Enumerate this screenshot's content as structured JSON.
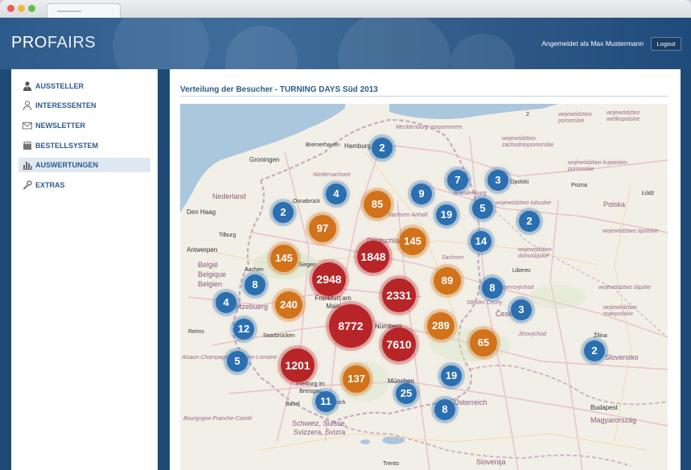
{
  "header": {
    "logo_pro": "PRO",
    "logo_fairs": "FAIRS",
    "user_text": "Angemeldet als Max Mustermann",
    "logout_label": "Logout"
  },
  "sidebar": {
    "items": [
      {
        "label": "AUSSTELLER",
        "icon": "user-suit-icon",
        "active": false
      },
      {
        "label": "INTERESSENTEN",
        "icon": "user-outline-icon",
        "active": false
      },
      {
        "label": "NEWSLETTER",
        "icon": "envelope-icon",
        "active": false
      },
      {
        "label": "BESTELLSYSTEM",
        "icon": "cart-icon",
        "active": false
      },
      {
        "label": "AUSWERTUNGEN",
        "icon": "bar-chart-icon",
        "active": true
      },
      {
        "label": "EXTRAS",
        "icon": "wrench-icon",
        "active": false
      }
    ]
  },
  "main": {
    "title": "Verteilung der Besucher - TURNING DAYS Süd 2013"
  },
  "map": {
    "labels": {
      "hamburg": "Hamburg",
      "bremerhaven": "Bremerhaven",
      "groningen": "Groningen",
      "nederland": "Nederland",
      "den_haag": "Den Haag",
      "osnabruck": "Osnabrück",
      "niedersachsen": "Niedersachsen",
      "sachsen_anhalt": "Sachsen-Anhalt",
      "brandenburg": "Brandenburg",
      "deutschland": "Deutschland",
      "sachsen": "Sachsen",
      "antwerpen": "Antwerpen",
      "belgie": "België",
      "belgique": "Belgique",
      "belgien": "Belgien",
      "aachen": "Aachen",
      "siegen": "Siegen",
      "frankfurt": "Frankfurt am Main",
      "letzebuerg": "Lëtzebuerg",
      "reims": "Reims",
      "saarbrucken": "Saarbrücken",
      "nurnberg": "Nürnberg",
      "alsace": "Alsace-Champagne-Ardenne-Lorraine",
      "freiburg": "Freiburg im Breisgau",
      "basel": "Basel",
      "munchen": "München",
      "osterreich": "Österreich",
      "schweiz": "Schweiz, Suisse, Svizzera, Svizra",
      "bourgogne": "Bourgogne-Franche-Comté",
      "polska": "Polska",
      "ceska": "Česká",
      "slovensko": "Slovensko",
      "budapest": "Budapest",
      "magyarorszag": "Magyarország",
      "slovenija": "Slovenija",
      "liberec": "Liberec",
      "zilina": "Žilina",
      "pomorskie": "województwo pomorskie",
      "zachodniopomorskie": "województwo zachodniopomorskie",
      "lubuskie": "województwo lubuskie",
      "dolnoslaskie": "województwo dolnośląskie",
      "kujawsko": "województwo kujawsko-pomorskie",
      "wielkopolskie": "województwo wielkopolskie",
      "opolskie": "województwo opolskie",
      "slaskie": "województwo śląskie",
      "malopolskie": "województwo małopolskie",
      "mecklenburg": "Mecklenburg-Vorpommern",
      "tilburg": "Tilburg",
      "trento": "Trento",
      "zurich": "Zürich",
      "stredni_cechy": "Střední Čechy",
      "severovychod": "Severovýchod",
      "jihovychod": "Jihovýchod",
      "lodz": "Łódź",
      "pozna": "Pozna",
      "opolski": "Opolski",
      "sz_num": "2"
    },
    "clusters": [
      {
        "value": "2",
        "color": "#2c6fb0"
      },
      {
        "value": "7",
        "color": "#2c6fb0"
      },
      {
        "value": "3",
        "color": "#2c6fb0"
      },
      {
        "value": "4",
        "color": "#2c6fb0"
      },
      {
        "value": "85",
        "color": "#d2731c"
      },
      {
        "value": "9",
        "color": "#2c6fb0"
      },
      {
        "value": "2",
        "color": "#2c6fb0"
      },
      {
        "value": "19",
        "color": "#2c6fb0"
      },
      {
        "value": "5",
        "color": "#2c6fb0"
      },
      {
        "value": "2",
        "color": "#2c6fb0"
      },
      {
        "value": "97",
        "color": "#d2731c"
      },
      {
        "value": "145",
        "color": "#d2731c"
      },
      {
        "value": "14",
        "color": "#2c6fb0"
      },
      {
        "value": "1848",
        "color": "#b82528"
      },
      {
        "value": "145",
        "color": "#d2731c"
      },
      {
        "value": "2948",
        "color": "#b82528"
      },
      {
        "value": "89",
        "color": "#d2731c"
      },
      {
        "value": "8",
        "color": "#2c6fb0"
      },
      {
        "value": "8",
        "color": "#2c6fb0"
      },
      {
        "value": "2331",
        "color": "#b82528"
      },
      {
        "value": "4",
        "color": "#2c6fb0"
      },
      {
        "value": "240",
        "color": "#d2731c"
      },
      {
        "value": "3",
        "color": "#2c6fb0"
      },
      {
        "value": "8772",
        "color": "#b82528"
      },
      {
        "value": "12",
        "color": "#2c6fb0"
      },
      {
        "value": "289",
        "color": "#d2731c"
      },
      {
        "value": "7610",
        "color": "#b82528"
      },
      {
        "value": "65",
        "color": "#d2731c"
      },
      {
        "value": "2",
        "color": "#2c6fb0"
      },
      {
        "value": "5",
        "color": "#2c6fb0"
      },
      {
        "value": "1201",
        "color": "#b82528"
      },
      {
        "value": "137",
        "color": "#d2731c"
      },
      {
        "value": "19",
        "color": "#2c6fb0"
      },
      {
        "value": "25",
        "color": "#2c6fb0"
      },
      {
        "value": "11",
        "color": "#2c6fb0"
      },
      {
        "value": "8",
        "color": "#2c6fb0"
      }
    ]
  }
}
